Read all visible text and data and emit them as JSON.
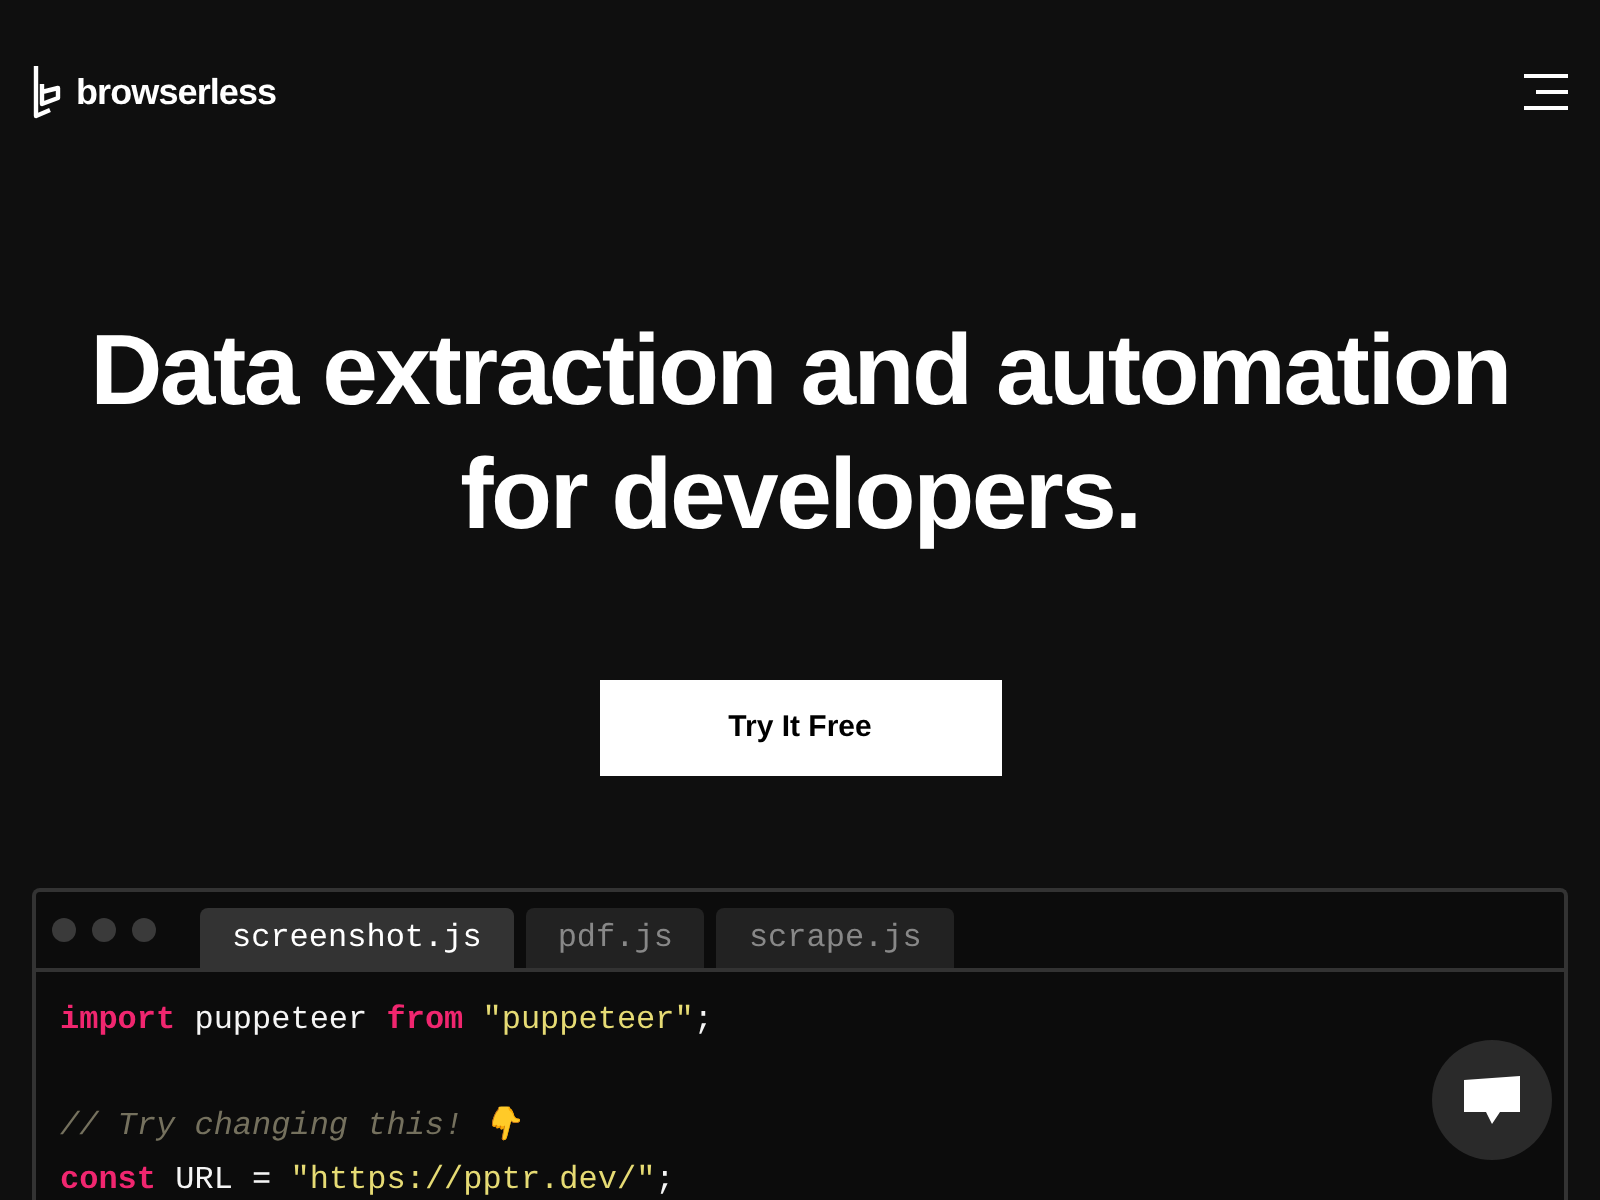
{
  "header": {
    "logo_text": "browserless"
  },
  "hero": {
    "title_lines": [
      "Data extraction and automation",
      "for developers."
    ],
    "cta": "Try It Free"
  },
  "editor": {
    "tabs": [
      {
        "label": "screenshot.js",
        "selected": true
      },
      {
        "label": "pdf.js",
        "selected": false
      },
      {
        "label": "scrape.js",
        "selected": false
      }
    ],
    "lines": [
      {
        "kind": "code",
        "tokens": [
          {
            "kind": "keyword",
            "text": "import"
          },
          {
            "kind": "plain",
            "text": " puppeteer "
          },
          {
            "kind": "keyword",
            "text": "from"
          },
          {
            "kind": "string",
            "text": " \"puppeteer\""
          },
          {
            "kind": "plain",
            "text": ";"
          }
        ]
      },
      {
        "kind": "blank"
      },
      {
        "kind": "code",
        "tokens": [
          {
            "kind": "comment",
            "text": "// Try changing this! 👇"
          }
        ]
      },
      {
        "kind": "code",
        "tokens": [
          {
            "kind": "keyword",
            "text": "const"
          },
          {
            "kind": "plain",
            "text": " URL = "
          },
          {
            "kind": "string",
            "text": "\"https://pptr.dev/\""
          },
          {
            "kind": "plain",
            "text": ";"
          }
        ]
      }
    ]
  }
}
